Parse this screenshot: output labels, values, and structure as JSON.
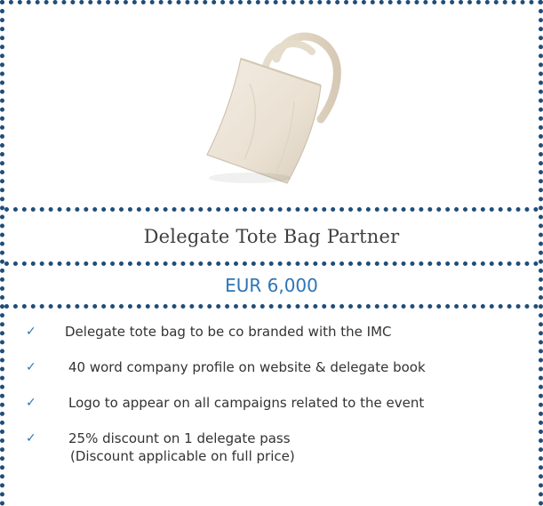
{
  "package": {
    "image_name": "tote-bag-image",
    "title": "Delegate Tote Bag Partner",
    "price": "EUR 6,000",
    "check_glyph": "✓",
    "benefits": [
      {
        "text": "Delegate tote bag to be co branded with the IMC"
      },
      {
        "text": "40 word company profile on website & delegate book"
      },
      {
        "text": "Logo to appear on all campaigns related to the event"
      },
      {
        "text": "25% discount on 1 delegate pass",
        "note": "(Discount applicable on full price)"
      }
    ]
  },
  "colors": {
    "border": "#1f4e79",
    "price": "#2e75b6",
    "title": "#3f3f3f"
  }
}
